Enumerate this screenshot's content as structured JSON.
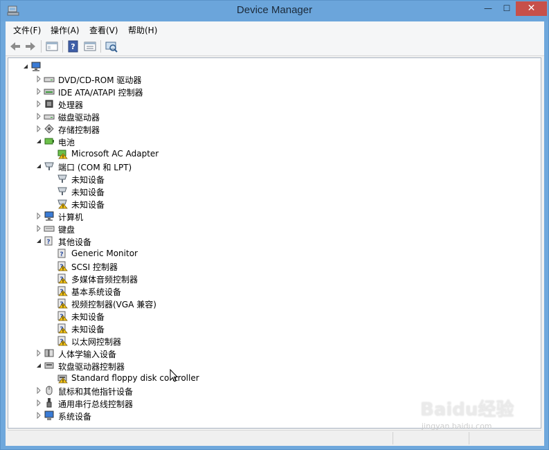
{
  "window": {
    "title": "Device Manager",
    "controls": {
      "minimize": "—",
      "maximize": "☐",
      "close": "✕"
    }
  },
  "menu": {
    "items": [
      "文件(F)",
      "操作(A)",
      "查看(V)",
      "帮助(H)"
    ]
  },
  "toolbar": {
    "buttons": [
      "back-icon",
      "forward-icon",
      "show-hide-console-tree-icon",
      "help-icon",
      "properties-icon",
      "scan-hardware-icon"
    ]
  },
  "tree": {
    "root_icon": "computer-icon",
    "items": [
      {
        "label": "DVD/CD-ROM 驱动器",
        "icon": "dvd-drive-icon",
        "expanded": false
      },
      {
        "label": "IDE ATA/ATAPI 控制器",
        "icon": "ide-controller-icon",
        "expanded": false
      },
      {
        "label": "处理器",
        "icon": "processor-icon",
        "expanded": false
      },
      {
        "label": "磁盘驱动器",
        "icon": "disk-drive-icon",
        "expanded": false
      },
      {
        "label": "存储控制器",
        "icon": "storage-controller-icon",
        "expanded": false
      },
      {
        "label": "电池",
        "icon": "battery-icon",
        "expanded": true,
        "children": [
          {
            "label": "Microsoft AC Adapter",
            "icon": "ac-adapter-warning-icon"
          }
        ]
      },
      {
        "label": "端口 (COM 和 LPT)",
        "icon": "port-icon",
        "expanded": true,
        "children": [
          {
            "label": "未知设备",
            "icon": "port-icon"
          },
          {
            "label": "未知设备",
            "icon": "port-icon"
          },
          {
            "label": "未知设备",
            "icon": "port-warning-icon"
          }
        ]
      },
      {
        "label": "计算机",
        "icon": "computer-icon",
        "expanded": false
      },
      {
        "label": "键盘",
        "icon": "keyboard-icon",
        "expanded": false
      },
      {
        "label": "其他设备",
        "icon": "other-devices-icon",
        "expanded": true,
        "children": [
          {
            "label": "Generic Monitor",
            "icon": "unknown-device-icon"
          },
          {
            "label": "SCSI 控制器",
            "icon": "unknown-device-warning-icon"
          },
          {
            "label": "多媒体音频控制器",
            "icon": "unknown-device-warning-icon"
          },
          {
            "label": "基本系统设备",
            "icon": "unknown-device-warning-icon"
          },
          {
            "label": "视频控制器(VGA 兼容)",
            "icon": "unknown-device-warning-icon"
          },
          {
            "label": "未知设备",
            "icon": "unknown-device-warning-icon"
          },
          {
            "label": "未知设备",
            "icon": "unknown-device-warning-icon"
          },
          {
            "label": "以太网控制器",
            "icon": "unknown-device-warning-icon"
          }
        ]
      },
      {
        "label": "人体学输入设备",
        "icon": "hid-icon",
        "expanded": false
      },
      {
        "label": "软盘驱动器控制器",
        "icon": "floppy-controller-icon",
        "expanded": true,
        "children": [
          {
            "label": "Standard floppy disk controller",
            "icon": "floppy-controller-warning-icon"
          }
        ]
      },
      {
        "label": "鼠标和其他指针设备",
        "icon": "mouse-icon",
        "expanded": false
      },
      {
        "label": "通用串行总线控制器",
        "icon": "usb-icon",
        "expanded": false
      },
      {
        "label": "系统设备",
        "icon": "system-devices-icon",
        "expanded": false
      }
    ]
  },
  "watermark": {
    "main": "Baidu经验",
    "sub": "jingyan.baidu.com"
  },
  "colors": {
    "titlebar": "#6ba5db",
    "close": "#c7504a",
    "warning": "#f5c518"
  }
}
